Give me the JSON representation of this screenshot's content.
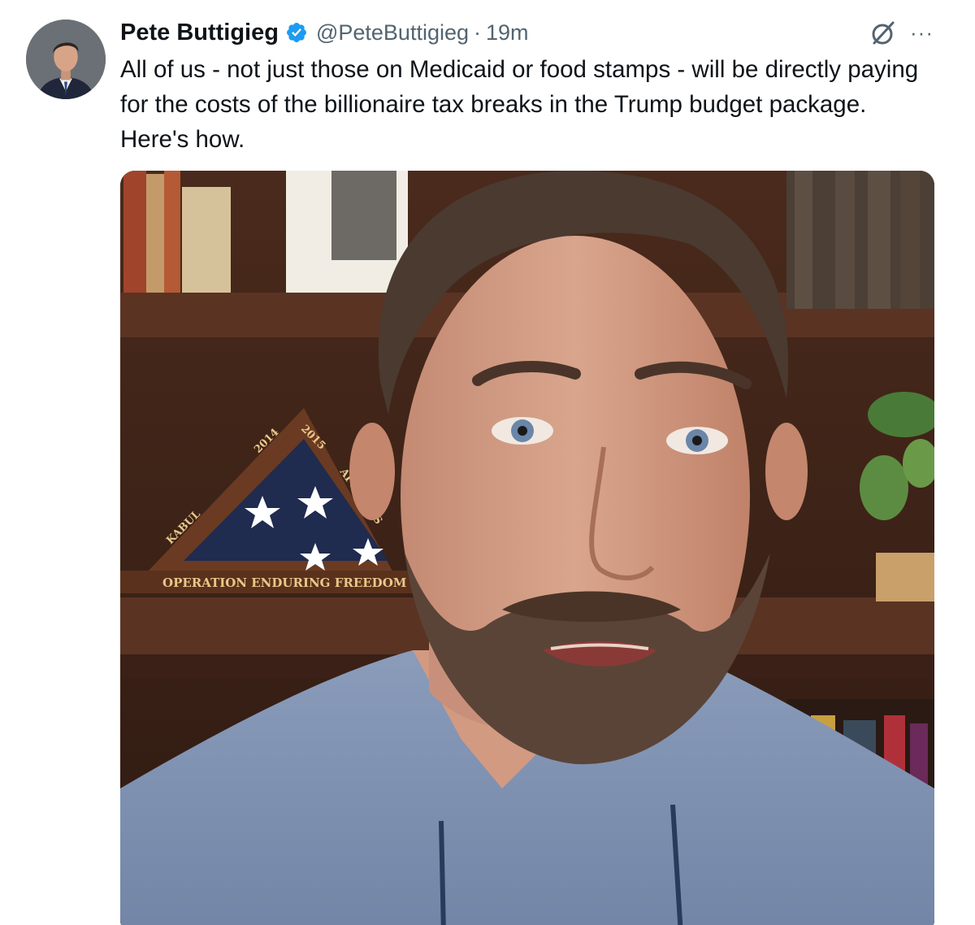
{
  "tweet": {
    "display_name": "Pete Buttigieg",
    "handle": "@PeteButtigieg",
    "separator": "·",
    "time": "19m",
    "text": "All of us - not just those on Medicaid or food stamps - will be directly paying for the costs of the billionaire tax breaks in the Trump budget package. Here's how.",
    "verified": true
  },
  "icons": {
    "verified": "verified-badge-icon",
    "grok": "grok-icon",
    "more": "more-icon"
  },
  "colors": {
    "verified_blue": "#1d9bf0",
    "secondary_text": "#536471",
    "primary_text": "#0f1419"
  },
  "media": {
    "type": "video-still",
    "flag_case_years_left": "2014",
    "flag_case_years_right": "2015",
    "flag_case_left": "KABUL",
    "flag_case_right": "AFGHANIS",
    "flag_case_plaque": "OPERATION ENDURING FREEDOM"
  }
}
